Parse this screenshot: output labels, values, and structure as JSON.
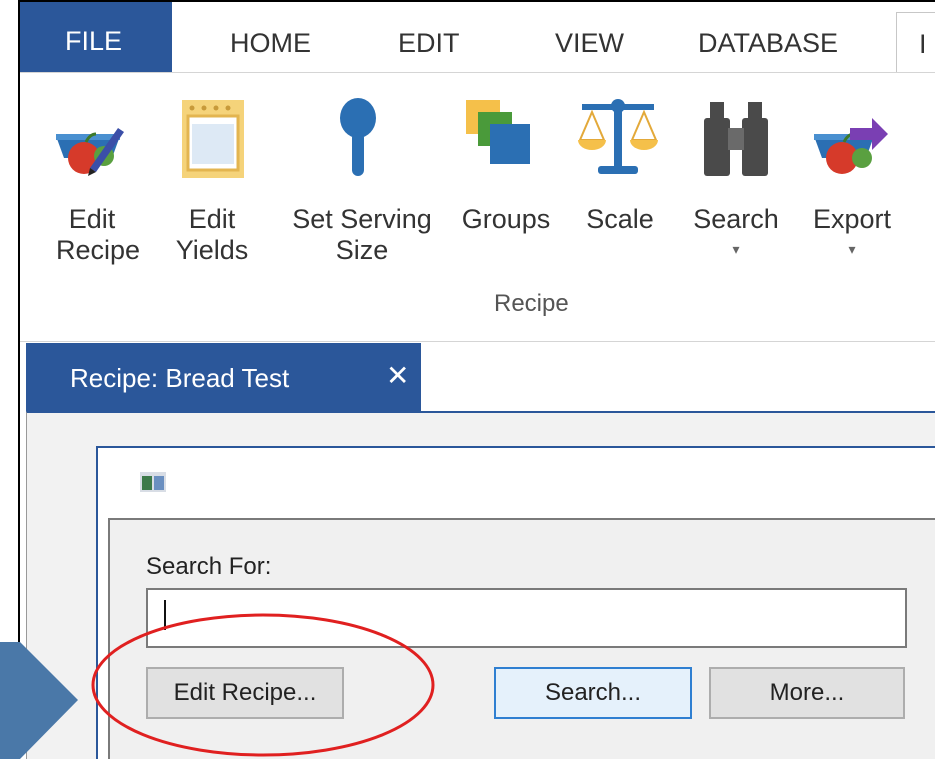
{
  "menu": {
    "file": "FILE",
    "tabs": [
      "HOME",
      "EDIT",
      "VIEW",
      "DATABASE"
    ],
    "partial_tab": "I"
  },
  "ribbon": {
    "buttons": [
      {
        "label": "Edit\nRecipe",
        "icon": "edit-recipe-icon"
      },
      {
        "label": "Edit\nYields",
        "icon": "oven-icon"
      },
      {
        "label": "Set Serving\nSize",
        "icon": "spoon-icon"
      },
      {
        "label": "Groups",
        "icon": "groups-icon"
      },
      {
        "label": "Scale",
        "icon": "scale-icon"
      },
      {
        "label": "Search",
        "icon": "binoculars-icon",
        "dropdown": "▾"
      },
      {
        "label": "Export",
        "icon": "export-icon",
        "dropdown": "▾"
      }
    ],
    "group_label": "Recipe"
  },
  "doc_tab": {
    "title": "Recipe: Bread Test",
    "close": "✕"
  },
  "dialog": {
    "search_label": "Search For:",
    "search_value": "",
    "buttons": {
      "edit": "Edit Recipe...",
      "search": "Search...",
      "more": "More..."
    }
  },
  "colors": {
    "accent": "#2b579a",
    "highlight": "#e02020",
    "arrow": "#4a78a8"
  }
}
